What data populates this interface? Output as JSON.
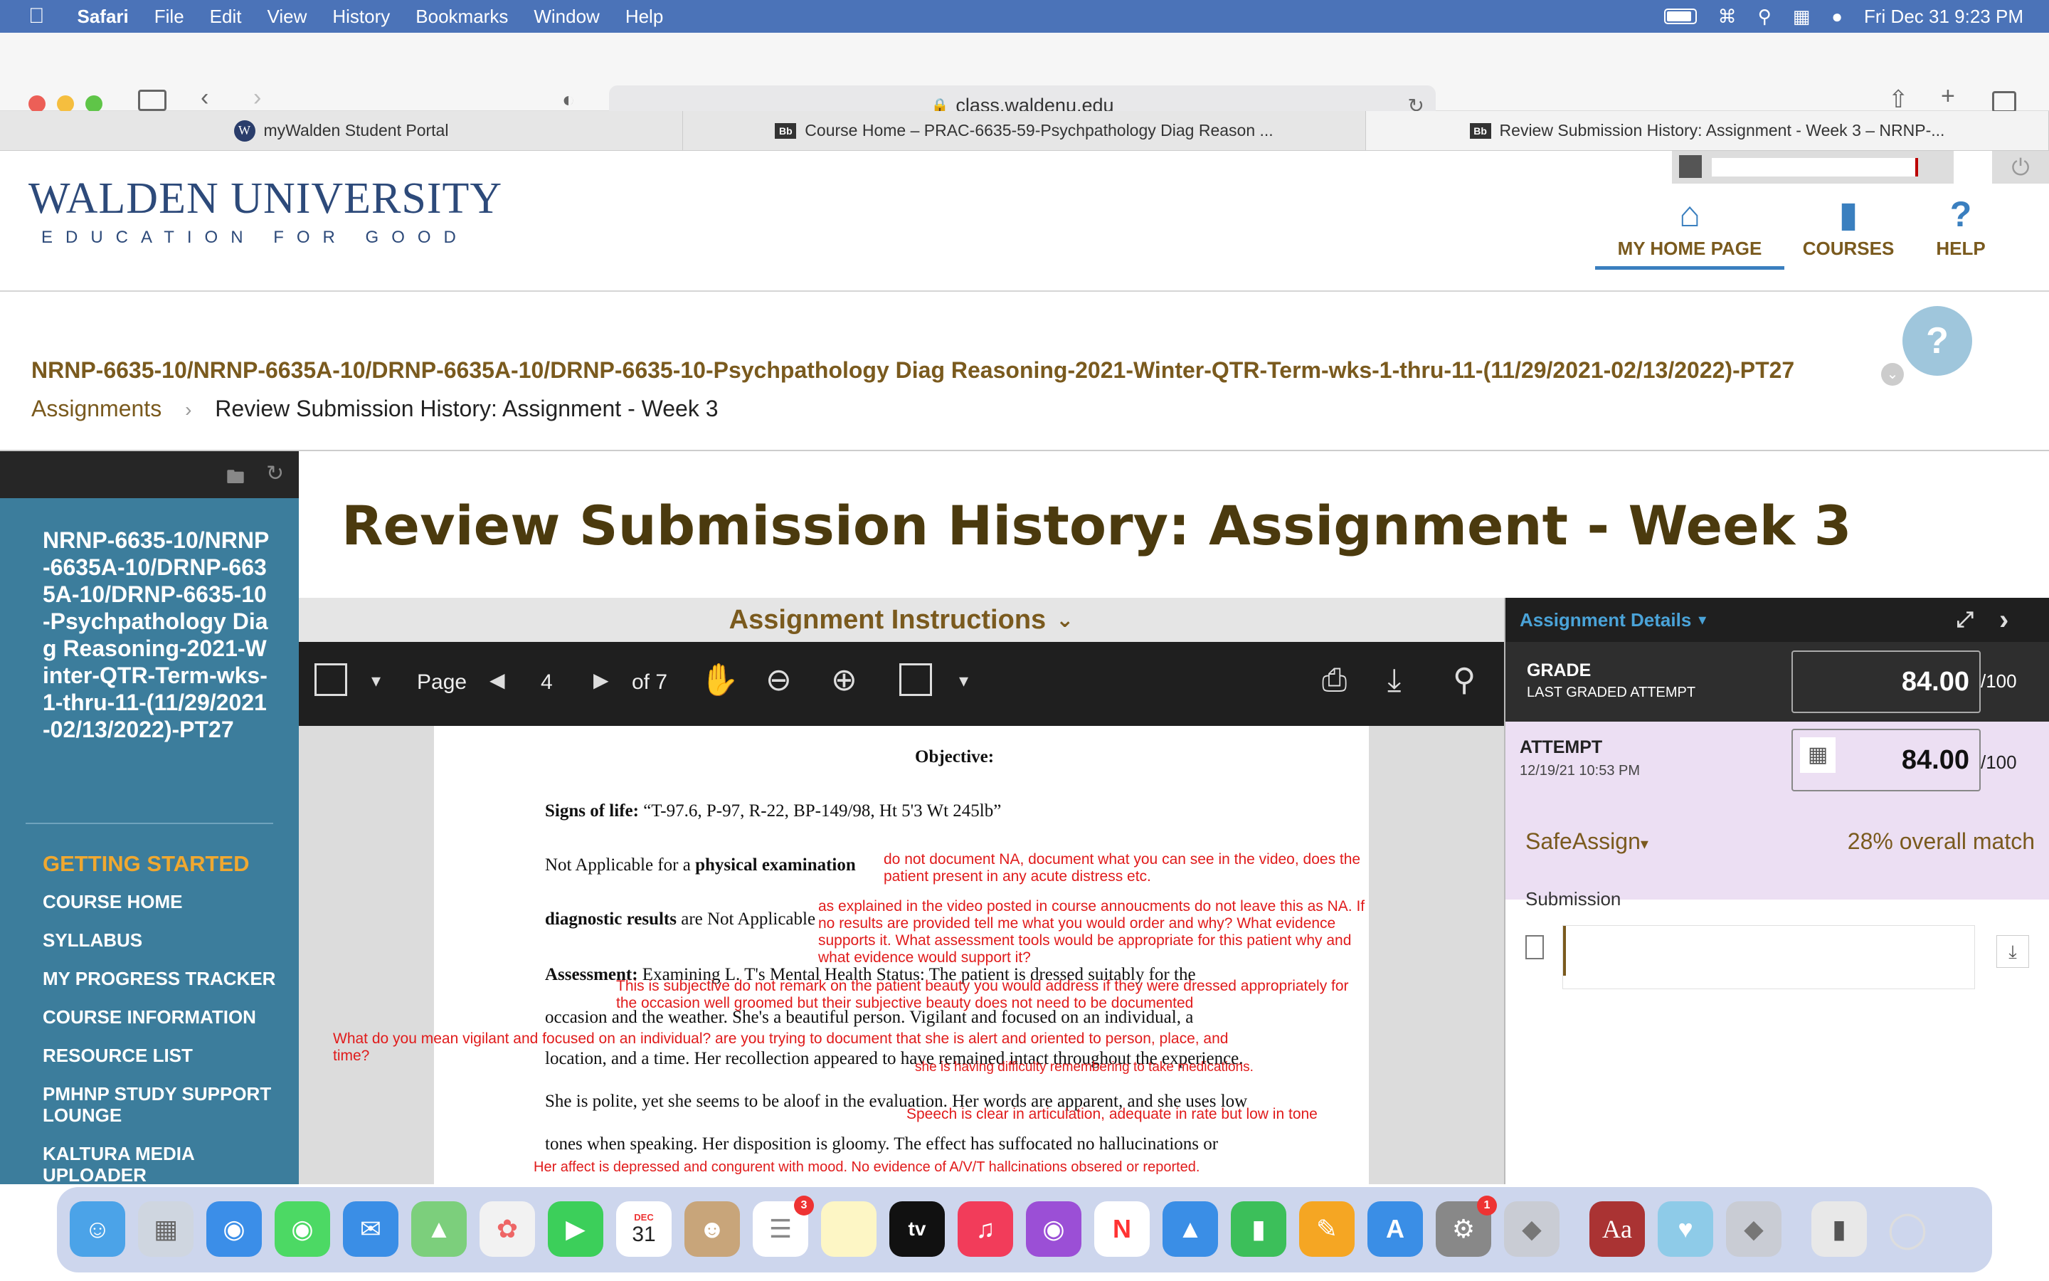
{
  "menubar": {
    "apple": "",
    "app": "Safari",
    "items": [
      "File",
      "Edit",
      "View",
      "History",
      "Bookmarks",
      "Window",
      "Help"
    ],
    "datetime": "Fri Dec 31  9:23 PM"
  },
  "browser": {
    "url": "class.waldenu.edu",
    "tabs": [
      {
        "label": "myWalden Student Portal",
        "favicon": "W"
      },
      {
        "label": "Course Home – PRAC-6635-59-Psychpathology Diag Reason ...",
        "favicon": "Bb"
      },
      {
        "label": "Review Submission History: Assignment - Week 3 – NRNP-...",
        "favicon": "Bb"
      }
    ]
  },
  "header": {
    "logo_main": "WALDEN UNIVERSITY",
    "logo_tagline": "EDUCATION FOR GOOD",
    "nav": {
      "home": "MY HOME PAGE",
      "courses": "COURSES",
      "help": "HELP"
    }
  },
  "course": {
    "title": "NRNP-6635-10/NRNP-6635A-10/DRNP-6635A-10/DRNP-6635-10-Psychpathology Diag Reasoning-2021-Winter-QTR-Term-wks-1-thru-11-(11/29/2021-02/13/2022)-PT27",
    "breadcrumb": {
      "parent": "Assignments",
      "separator": "›",
      "current": "Review Submission History: Assignment - Week 3"
    }
  },
  "sidebar": {
    "course_name": "NRNP-6635-10/NRNP-6635A-10/DRNP-6635A-10/DRNP-6635-10-Psychpathology Diag Reasoning-2021-Winter-QTR-Term-wks-1-thru-11-(11/29/2021-02/13/2022)-PT27",
    "section_heading": "GETTING STARTED",
    "items": [
      "COURSE HOME",
      "SYLLABUS",
      "MY PROGRESS TRACKER",
      "COURSE INFORMATION",
      "RESOURCE LIST",
      "PMHNP STUDY SUPPORT LOUNGE",
      "KALTURA MEDIA UPLOADER"
    ]
  },
  "main": {
    "page_title": "Review Submission History: Assignment - Week 3",
    "instructions_label": "Assignment Instructions",
    "pdf": {
      "page_label": "Page",
      "page": "4",
      "of": "of 7"
    }
  },
  "document": {
    "heading": "Objective:",
    "vitals_label": "Signs of life:",
    "vitals": "“T-97.6, P-97, R-22, BP-149/98, Ht 5'3 Wt 245lb”",
    "line_pe_a": "Not Applicable for a ",
    "line_pe_b": "physical examination",
    "line_dx_a": "diagnostic results",
    "line_dx_b": " are Not Applicable",
    "assess_label": "Assessment:",
    "assess_text": "  Examining L. T's Mental Health Status: The patient is dressed suitably for the",
    "assess_2": "occasion and the weather. She's a beautiful person.  Vigilant and focused on an individual, a",
    "assess_3": "location, and a time. Her recollection appeared to have remained intact throughout the experience.",
    "polite": "She is polite, yet she seems to be aloof in the evaluation. Her words are apparent, and she uses low",
    "tones": "tones when speaking. Her disposition is gloomy. The effect has suffocated no hallucinations or",
    "comments": [
      "do not document NA, document what you can see in the video, does the patient present in any acute distress etc.",
      "as explained in the video posted in course annoucments do not leave this as NA. If no results are provided tell me what you would order and why? What evidence supports it. What assessment tools would be appropriate for this patient why and what evidence would support it?",
      "This is subjective do not remark on the patient beauty you would address if they were dressed appropriately for the occasion well groomed but their subjective beauty does not need to be documented",
      "What do you mean vigilant and focused on an individual? are you trying to document that she is alert and oriented to person, place, and time?",
      "she is having difficulty remembering to take medications.",
      "Speech is clear in articulation, adequate in rate but low in tone",
      "Her affect is depressed and congurent with mood. No evidence of A/V/T hallcinations obsered or reported."
    ]
  },
  "details": {
    "title": "Assignment Details",
    "grade_label": "GRADE",
    "grade_sub": "LAST GRADED ATTEMPT",
    "grade_value": "84.00",
    "out_of": "/100",
    "attempt_label": "ATTEMPT",
    "attempt_date": "12/19/21 10:53 PM",
    "attempt_value": "84.00",
    "safeassign_label": "SafeAssign",
    "safeassign_match": "28% overall match",
    "submission_label": "Submission"
  },
  "dock": {
    "calendar_month": "DEC",
    "calendar_day": "31",
    "reminders_badge": "3",
    "settings_badge": "1",
    "dictionary": "Aa",
    "tv": "tv"
  },
  "colors": {
    "accent_gold": "#7a5a1e",
    "sidebar_blue": "#3c7d9c",
    "comment_red": "#e01b1b",
    "attempt_bg": "#ecdff3"
  }
}
